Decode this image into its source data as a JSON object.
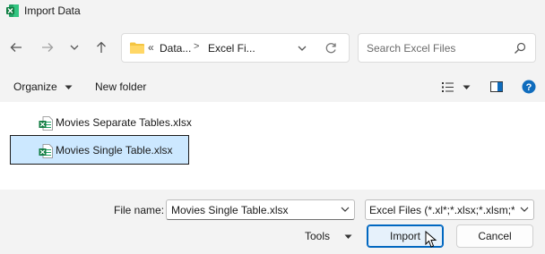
{
  "window": {
    "title": "Import Data"
  },
  "navigation": {
    "back_icon": "arrow-left-icon",
    "forward_icon": "arrow-right-icon",
    "recent_icon": "chevron-down-icon",
    "up_icon": "arrow-up-icon"
  },
  "address": {
    "prefix": "«",
    "crumbs": [
      "Data...",
      "Excel Fi..."
    ]
  },
  "search": {
    "placeholder": "Search Excel Files"
  },
  "commands": {
    "organize": "Organize",
    "new_folder": "New folder"
  },
  "files": [
    {
      "name": "Movies Separate Tables.xlsx",
      "selected": false
    },
    {
      "name": "Movies Single Table.xlsx",
      "selected": true
    }
  ],
  "footer": {
    "file_name_label": "File name:",
    "file_name_value": "Movies Single Table.xlsx",
    "file_type_value": "Excel Files (*.xl*;*.xlsx;*.xlsm;*.xlsb;*.xlam;*.xltx)",
    "tools_label": "Tools",
    "import_label": "Import",
    "cancel_label": "Cancel"
  },
  "colors": {
    "accent": "#0067c0",
    "selection": "#cce8ff",
    "excel_green": "#1d6f42",
    "folder_yellow": "#f4c542",
    "help_blue": "#0f6cbd"
  }
}
